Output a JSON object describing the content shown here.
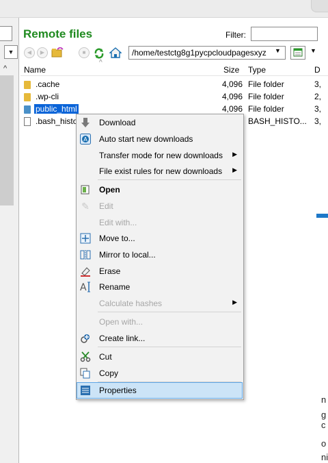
{
  "remote": {
    "title": "Remote files",
    "filter_label": "Filter:",
    "path": "/home/testctg8g1pycpcloudpagesxyz"
  },
  "columns": {
    "name": "Name",
    "size": "Size",
    "type": "Type",
    "date": "D"
  },
  "rows": [
    {
      "name": ".cache",
      "size": "4,096",
      "type": "File folder",
      "date": "3,"
    },
    {
      "name": ".wp-cli",
      "size": "4,096",
      "type": "File folder",
      "date": "2,"
    },
    {
      "name": "public_html",
      "size": "4,096",
      "type": "File folder",
      "date": "3,"
    },
    {
      "name": ".bash_histo",
      "size": "",
      "type": "BASH_HISTO...",
      "date": "3,"
    }
  ],
  "menu": {
    "download": "Download",
    "auto_start": "Auto start new downloads",
    "transfer_mode": "Transfer mode for new downloads",
    "file_exist": "File exist rules for new downloads",
    "open": "Open",
    "edit": "Edit",
    "edit_with": "Edit with...",
    "move_to": "Move to...",
    "mirror": "Mirror to local...",
    "erase": "Erase",
    "rename": "Rename",
    "calc_hashes": "Calculate hashes",
    "open_with": "Open with...",
    "create_link": "Create link...",
    "cut": "Cut",
    "copy": "Copy",
    "properties": "Properties"
  },
  "edge_text": [
    "n",
    "g c",
    "o",
    "ni"
  ],
  "colors": {
    "title_green": "#1f8a1f",
    "selection_blue": "#0a64d8",
    "menu_highlight": "#cce4f7"
  }
}
